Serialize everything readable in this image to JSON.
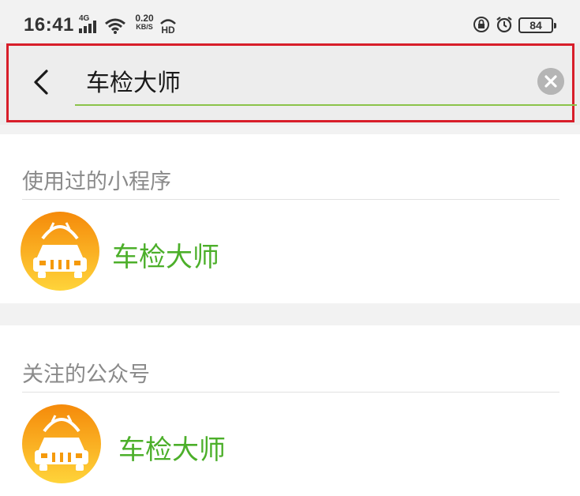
{
  "status_bar": {
    "time": "16:41",
    "network_type": "4G",
    "net_speed_value": "0.20",
    "net_speed_unit": "KB/S",
    "hd_label": "HD",
    "battery_level": "84"
  },
  "search": {
    "query": "车检大师"
  },
  "sections": [
    {
      "title": "使用过的小程序",
      "items": [
        {
          "name": "车检大师",
          "icon": "car-inspection-app-icon"
        }
      ]
    },
    {
      "title": "关注的公众号",
      "items": [
        {
          "name": "车检大师",
          "icon": "car-inspection-app-icon"
        }
      ]
    }
  ],
  "colors": {
    "accent_green": "#4caf2a",
    "underline_green": "#8bc34a",
    "highlight_red": "#d81e2a",
    "avatar_orange": "#f59a0c",
    "avatar_yellow": "#ffcf2e"
  }
}
